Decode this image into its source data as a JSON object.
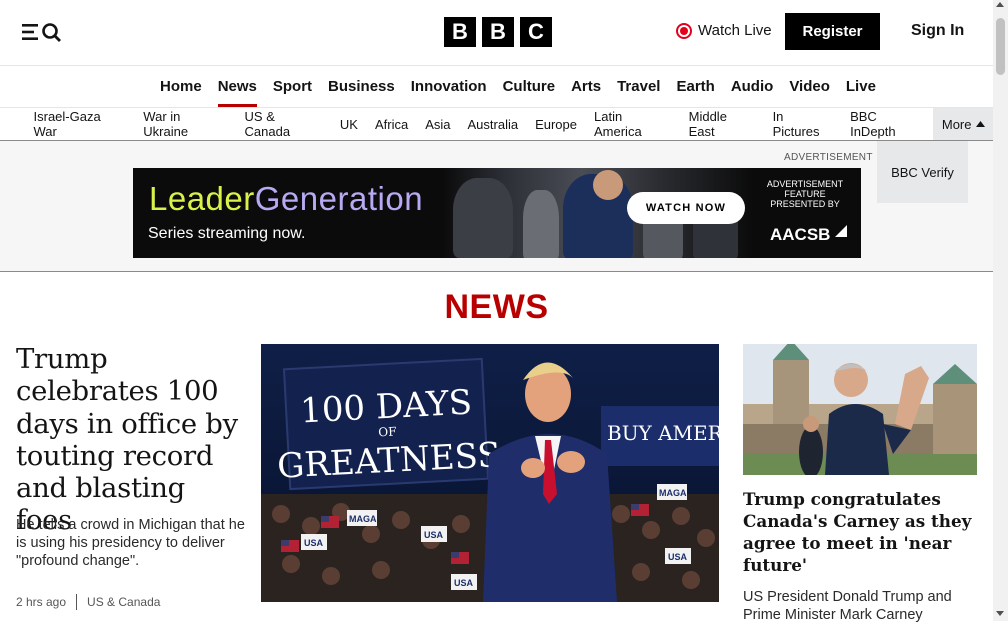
{
  "header": {
    "menu_icon": "hamburger-menu-icon",
    "search_icon": "search-icon",
    "logo_letters": [
      "B",
      "B",
      "C"
    ],
    "watch_live_label": "Watch Live",
    "register_label": "Register",
    "sign_in_label": "Sign In"
  },
  "nav": {
    "items": [
      "Home",
      "News",
      "Sport",
      "Business",
      "Innovation",
      "Culture",
      "Arts",
      "Travel",
      "Earth",
      "Audio",
      "Video",
      "Live"
    ],
    "active": "News"
  },
  "subnav": {
    "items": [
      "Israel-Gaza War",
      "War in Ukraine",
      "US & Canada",
      "UK",
      "Africa",
      "Asia",
      "Australia",
      "Europe",
      "Latin America",
      "Middle East",
      "In Pictures",
      "BBC InDepth"
    ],
    "more_label": "More",
    "dropdown_items": [
      "BBC Verify"
    ]
  },
  "ad": {
    "label": "ADVERTISEMENT",
    "title_part1": "Leader",
    "title_part2": "Generation",
    "subtitle": "Series streaming now.",
    "cta": "WATCH NOW",
    "presented_line1": "ADVERTISEMENT",
    "presented_line2": "FEATURE",
    "presented_line3": "PRESENTED BY",
    "sponsor": "AACSB"
  },
  "section": {
    "title": "NEWS"
  },
  "main_story": {
    "headline": "Trump celebrates 100 days in office by touting record and blasting foes",
    "summary": "He tells a crowd in Michigan that he is using his presidency to deliver \"profound change\".",
    "time": "2 hrs ago",
    "category": "US & Canada"
  },
  "hero_image": {
    "sign_line1": "100 DAYS",
    "sign_line2": "OF",
    "sign_line3": "GREATNESS",
    "banner_text": "BUY AMERICA",
    "placards": [
      "USA",
      "MAGA",
      "USA",
      "MAGA",
      "USA",
      "USA"
    ]
  },
  "side_story": {
    "headline": "Trump congratulates Canada's Carney as they agree to meet in 'near future'",
    "summary": "US President Donald Trump and Prime Minister Mark Carney"
  },
  "colors": {
    "brand_red": "#b80000",
    "live_red": "#e2001a",
    "ad_lime": "#d9f24a",
    "ad_lavender": "#b7aaf2"
  }
}
